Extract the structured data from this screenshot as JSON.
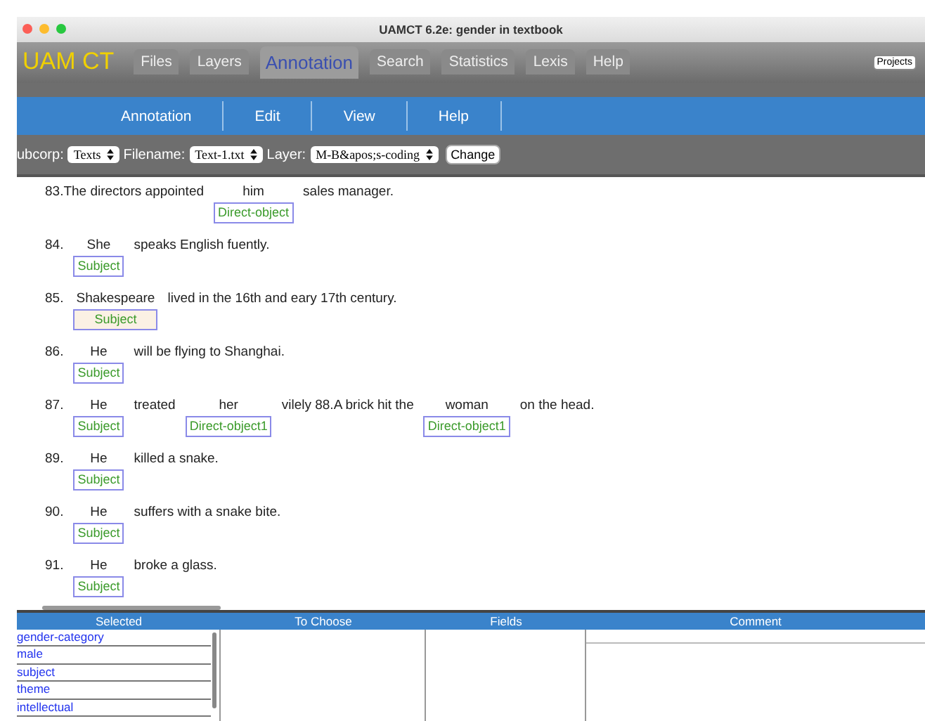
{
  "window": {
    "title": "UAMCT 6.2e: gender in textbook"
  },
  "logo": "UAM CT",
  "tabs": [
    {
      "label": "Files",
      "selected": false
    },
    {
      "label": "Layers",
      "selected": false
    },
    {
      "label": "Annotation",
      "selected": true
    },
    {
      "label": "Search",
      "selected": false
    },
    {
      "label": "Statistics",
      "selected": false
    },
    {
      "label": "Lexis",
      "selected": false
    },
    {
      "label": "Help",
      "selected": false
    }
  ],
  "projects_button": "Projects",
  "menu": [
    "Annotation",
    "Edit",
    "View",
    "Help"
  ],
  "toolbar": {
    "subcorp_label": "ubcorp:",
    "subcorp": "Texts",
    "filename_label": "Filename:",
    "filename": "Text-1.txt",
    "layer_label": "Layer:",
    "layer": "M-B&apos;s-coding",
    "change_button": "Change"
  },
  "sentences": [
    [
      {
        "text": "83.The directors appointed"
      },
      {
        "text": "him",
        "tag": {
          "label": "Direct-object",
          "highlighted": false
        }
      },
      {
        "text": "sales manager."
      }
    ],
    [
      {
        "text": "84."
      },
      {
        "text": "She",
        "tag": {
          "label": "Subject",
          "highlighted": false
        }
      },
      {
        "text": "speaks English fuently."
      }
    ],
    [
      {
        "text": "85."
      },
      {
        "text": "Shakespeare",
        "tag": {
          "label": "Subject",
          "highlighted": true
        }
      },
      {
        "text": "lived in the 16th and eary 17th century."
      }
    ],
    [
      {
        "text": "86."
      },
      {
        "text": "He",
        "tag": {
          "label": "Subject",
          "highlighted": false
        }
      },
      {
        "text": "will be flying to Shanghai."
      }
    ],
    [
      {
        "text": "87."
      },
      {
        "text": "He",
        "tag": {
          "label": "Subject",
          "highlighted": false
        }
      },
      {
        "text": "treated"
      },
      {
        "text": "her",
        "tag": {
          "label": "Direct-object1",
          "highlighted": false
        }
      },
      {
        "text": "vilely 88.A brick hit the"
      },
      {
        "text": "woman",
        "tag": {
          "label": "Direct-object1",
          "highlighted": false
        }
      },
      {
        "text": "on the head."
      }
    ],
    [
      {
        "text": "89."
      },
      {
        "text": "He",
        "tag": {
          "label": "Subject",
          "highlighted": false
        }
      },
      {
        "text": "killed a snake."
      }
    ],
    [
      {
        "text": "90."
      },
      {
        "text": "He",
        "tag": {
          "label": "Subject",
          "highlighted": false
        }
      },
      {
        "text": "suffers with a snake bite."
      }
    ],
    [
      {
        "text": "91."
      },
      {
        "text": "He",
        "tag": {
          "label": "Subject",
          "highlighted": false
        }
      },
      {
        "text": "broke a glass."
      }
    ]
  ],
  "panel": {
    "columns": [
      "Selected",
      "To Choose",
      "Fields",
      "Comment"
    ],
    "selected_items": [
      "gender-category",
      "male",
      "subject",
      "theme",
      "intellectual"
    ]
  }
}
